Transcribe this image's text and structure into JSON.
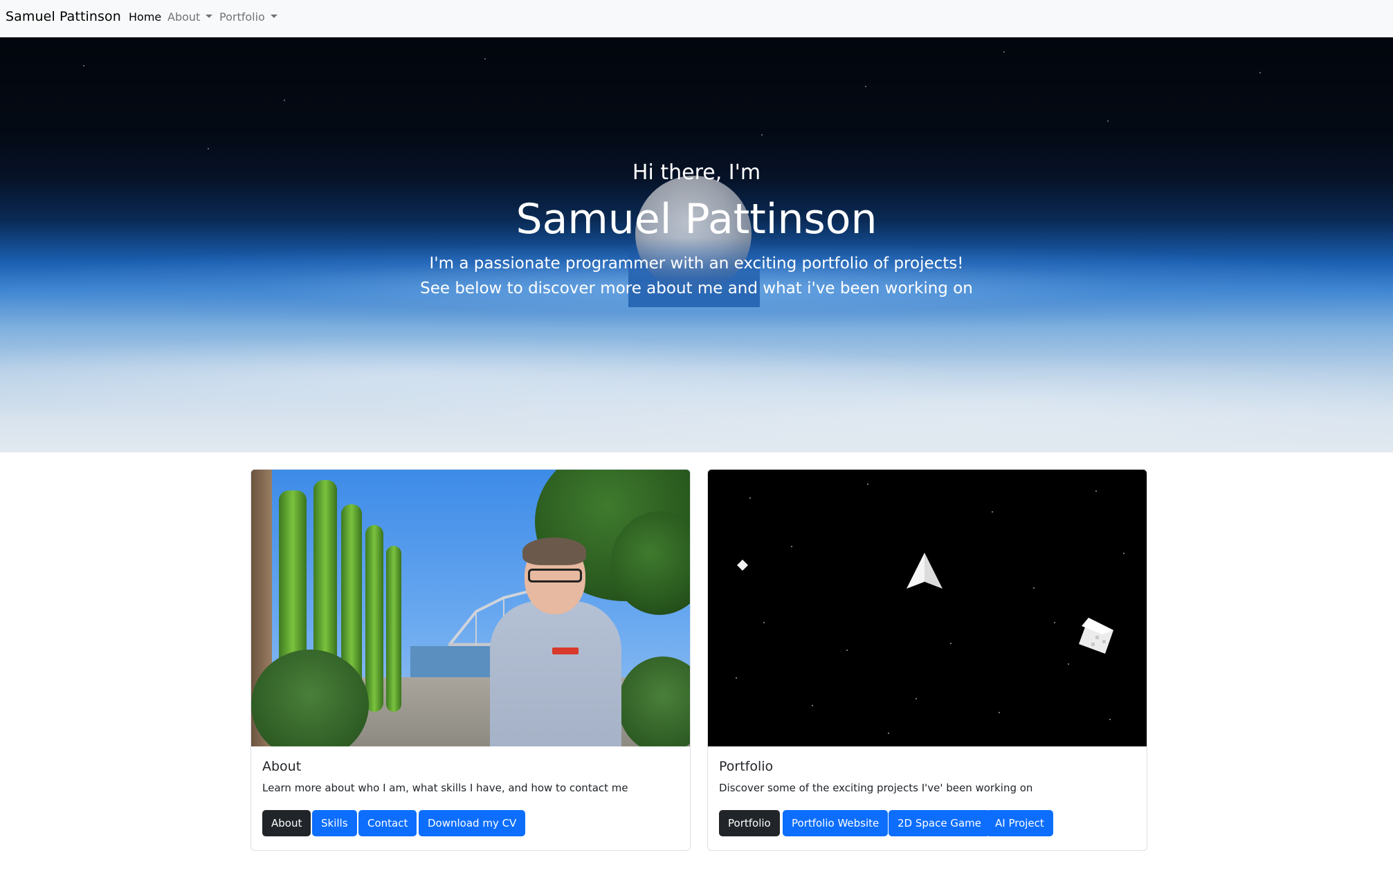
{
  "navbar": {
    "brand": "Samuel Pattinson",
    "items": [
      {
        "label": "Home"
      },
      {
        "label": "About"
      },
      {
        "label": "Portfolio"
      }
    ]
  },
  "hero": {
    "greeting": "Hi there, I'm",
    "name": "Samuel Pattinson",
    "line1": "I'm a passionate programmer with an exciting portfolio of projects!",
    "line2": "See below to discover more about me and what i've been working on"
  },
  "cards": [
    {
      "title": "About",
      "text": "Learn more about who I am, what skills I have, and how to contact me",
      "buttons": [
        "About",
        "Skills",
        "Contact",
        "Download my CV"
      ]
    },
    {
      "title": "Portfolio",
      "text": "Discover some of the exciting projects I've' been working on",
      "buttons": [
        "Portfolio",
        "Portfolio Website",
        "2D Space Game",
        "AI Project"
      ]
    }
  ],
  "colors": {
    "primary": "#0d6efd",
    "dark": "#212529",
    "navbar_bg": "#f8f9fa"
  }
}
